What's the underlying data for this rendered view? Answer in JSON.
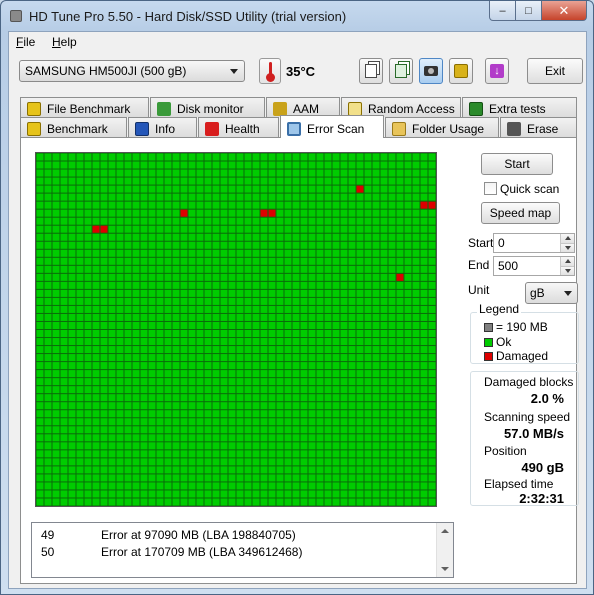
{
  "window": {
    "title": "HD Tune Pro 5.50 - Hard Disk/SSD Utility (trial version)",
    "minimize_glyph": "–",
    "maximize_glyph": "□",
    "close_glyph": "✕"
  },
  "menu": {
    "items": [
      {
        "label": "File",
        "accel": "F"
      },
      {
        "label": "Help",
        "accel": "H"
      }
    ]
  },
  "toolbar": {
    "drive": "SAMSUNG HM500JI (500 gB)",
    "temperature": "35°C",
    "exit_label": "Exit",
    "icons": [
      "copy-text-icon",
      "copy-info-icon",
      "screenshot-camera-icon",
      "options-chip-icon",
      "download-arrow-icon"
    ]
  },
  "tabs": {
    "row1": [
      "File Benchmark",
      "Disk monitor",
      "AAM",
      "Random Access",
      "Extra tests"
    ],
    "row2": [
      "Benchmark",
      "Info",
      "Health",
      "Error Scan",
      "Folder Usage",
      "Erase"
    ],
    "active": "Error Scan"
  },
  "scan": {
    "start_label": "Start",
    "quick_scan_label": "Quick scan",
    "quick_scan_checked": false,
    "speed_map_label": "Speed map",
    "start_field_label": "Start",
    "start_value": "0",
    "end_field_label": "End",
    "end_value": "500",
    "unit_label": "Unit",
    "unit_value": "gB",
    "grid": {
      "cols": 50,
      "rows": 44,
      "block_size": "190 MB",
      "scanned_blocks": 2583,
      "damaged_cells": [
        [
          7,
          9
        ],
        [
          8,
          9
        ],
        [
          18,
          7
        ],
        [
          28,
          7
        ],
        [
          29,
          7
        ],
        [
          40,
          4
        ],
        [
          48,
          6
        ],
        [
          49,
          6
        ],
        [
          45,
          15
        ]
      ],
      "colors": {
        "ok": "#00cc00",
        "damaged": "#dd0000",
        "pending": "#808080",
        "line": "#0a6b0a"
      }
    }
  },
  "legend": {
    "title": "Legend",
    "block_label": "= 190 MB",
    "ok_label": "Ok",
    "damaged_label": "Damaged"
  },
  "stats": {
    "damaged_blocks_label": "Damaged blocks",
    "damaged_blocks_value": "2.0 %",
    "scanning_speed_label": "Scanning speed",
    "scanning_speed_value": "57.0 MB/s",
    "position_label": "Position",
    "position_value": "490 gB",
    "elapsed_label": "Elapsed time",
    "elapsed_value": "2:32:31"
  },
  "log": [
    {
      "num": "49",
      "msg": "Error at 97090 MB (LBA 198840705)"
    },
    {
      "num": "50",
      "msg": "Error at 170709 MB (LBA 349612468)"
    }
  ]
}
